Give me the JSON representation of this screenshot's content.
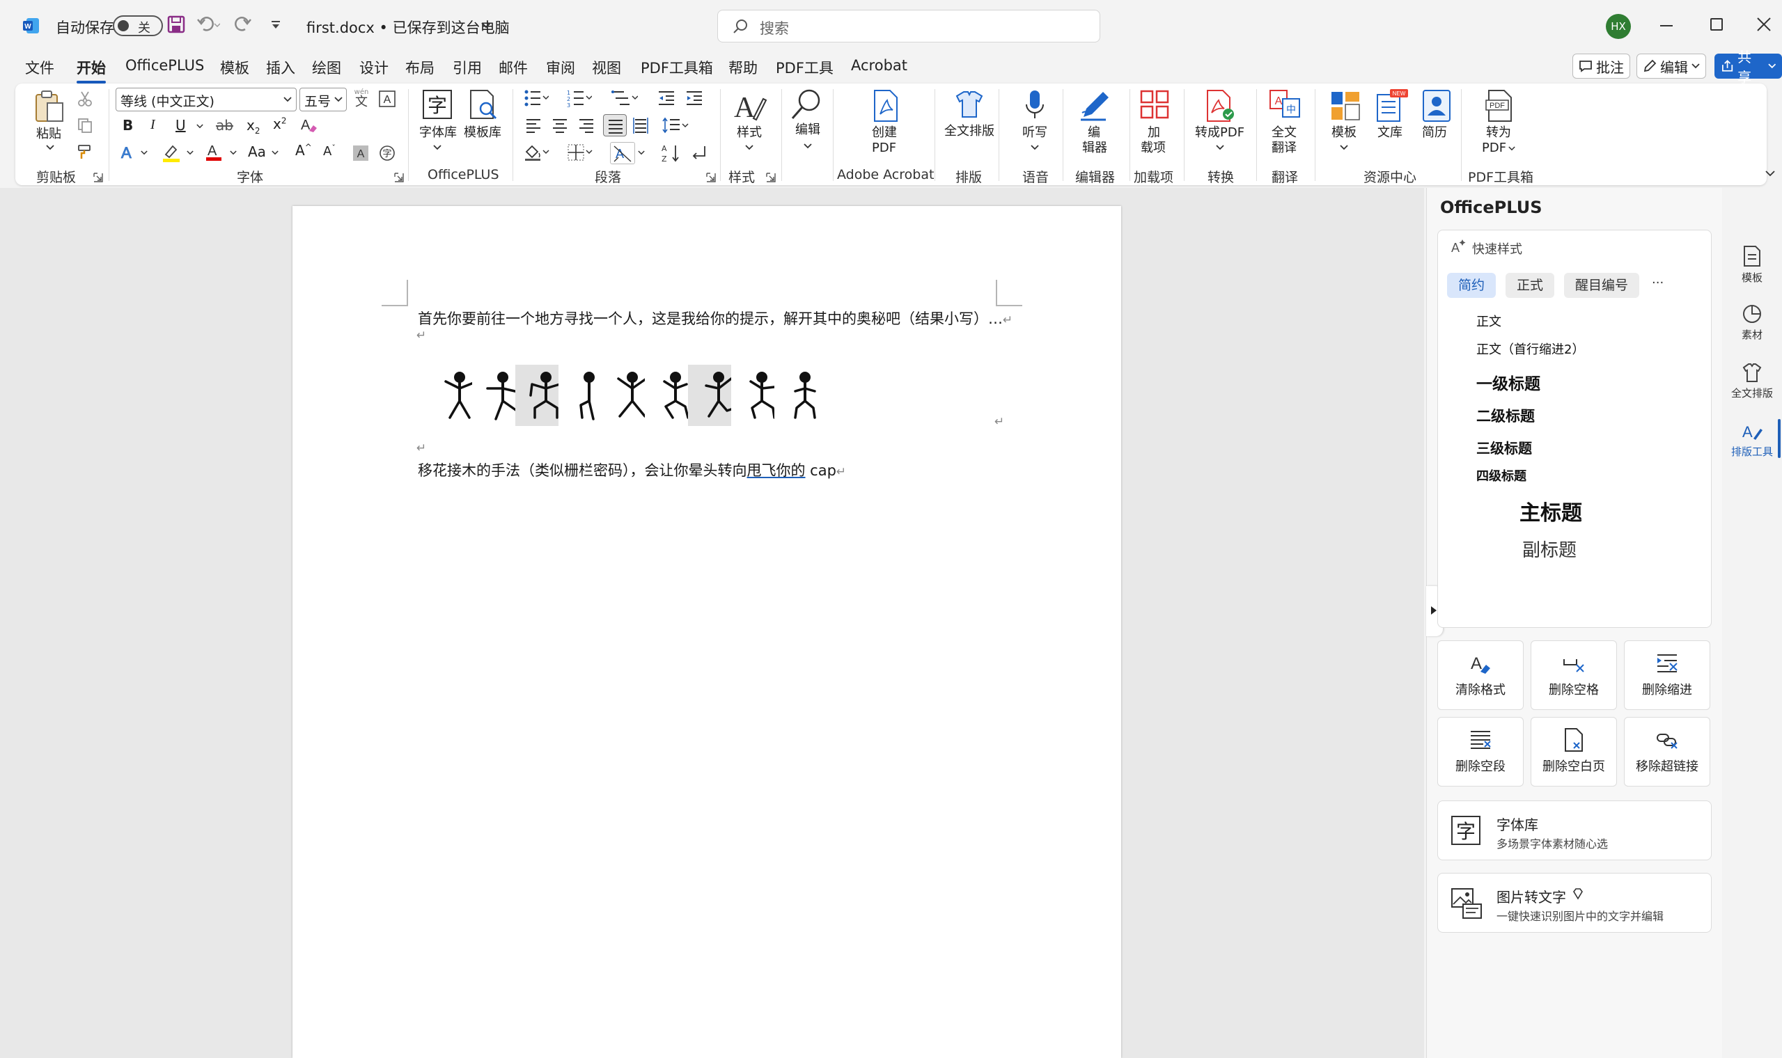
{
  "titlebar": {
    "autosave_label": "自动保存",
    "autosave_state": "关",
    "doc_title": "first.docx • 已保存到这台电脑",
    "search_placeholder": "搜索",
    "avatar_initials": "HX"
  },
  "menu": {
    "tabs": [
      "文件",
      "开始",
      "OfficePLUS",
      "模板",
      "插入",
      "绘图",
      "设计",
      "布局",
      "引用",
      "邮件",
      "审阅",
      "视图",
      "PDF工具箱",
      "帮助",
      "PDF工具",
      "Acrobat"
    ],
    "active_tab": "开始",
    "comment_btn": "批注",
    "edit_btn": "编辑",
    "share_btn": "共享"
  },
  "ribbon": {
    "clipboard": {
      "paste": "粘贴",
      "group": "剪贴板"
    },
    "font": {
      "font_name": "等线 (中文正文)",
      "font_size": "五号",
      "group": "字体",
      "pinyin": "wén"
    },
    "officeplus": {
      "font_lib": "字体库",
      "template_lib": "模板库",
      "group": "OfficePLUS"
    },
    "paragraph": {
      "group": "段落"
    },
    "styles": {
      "styles": "样式",
      "group": "样式"
    },
    "editing": {
      "label": "编辑"
    },
    "acrobat": {
      "create_pdf_1": "创建",
      "create_pdf_2": "PDF",
      "group": "Adobe Acrobat"
    },
    "layout": {
      "full_layout": "全文排版",
      "group": "排版"
    },
    "voice": {
      "dictate": "听写",
      "group": "语音"
    },
    "editor": {
      "l1": "编",
      "l2": "辑器",
      "group": "编辑器"
    },
    "addins": {
      "l1": "加",
      "l2": "载项",
      "group": "加载项"
    },
    "convert": {
      "to_pdf": "转成PDF",
      "group": "转换"
    },
    "translate": {
      "l1": "全文",
      "l2": "翻译",
      "group": "翻译"
    },
    "resources": {
      "template": "模板",
      "library": "文库",
      "resume": "简历",
      "new_badge": "NEW",
      "group": "资源中心"
    },
    "pdftools": {
      "l1": "转为",
      "l2": "PDF",
      "group": "PDF工具箱"
    }
  },
  "document": {
    "line1": "首先你要前往一个地方寻找一个人，这是我给你的提示，解开其中的奥秘吧（结果小写）…",
    "line2_prefix": "移花接木的手法（类似栅栏密码），会让你晕头转向",
    "line2_link": "甩飞你的",
    "line2_suffix": " cap",
    "para_mark": "↵",
    "figure_count": 9
  },
  "pane": {
    "title": "OfficePLUS",
    "quick_style_label": "快速样式",
    "chips": [
      "简约",
      "正式",
      "醒目编号"
    ],
    "more": "···",
    "styles": {
      "body": "正文",
      "body_indent": "正文（首行缩进2）",
      "h1": "一级标题",
      "h2": "二级标题",
      "h3": "三级标题",
      "h4": "四级标题",
      "title": "主标题",
      "subtitle": "副标题"
    },
    "tools": [
      "清除格式",
      "删除空格",
      "删除缩进",
      "删除空段",
      "删除空白页",
      "移除超链接"
    ],
    "font_lib_title": "字体库",
    "font_lib_desc": "多场景字体素材随心选",
    "ocr_title": "图片转文字",
    "ocr_desc": "一键快速识别图片中的文字并编辑"
  },
  "rail": {
    "items": [
      "模板",
      "素材",
      "全文排版",
      "排版工具"
    ]
  },
  "colors": {
    "accent": "#185abd",
    "share_bg": "#1e66c9",
    "avatar_bg": "#2f7d32"
  }
}
